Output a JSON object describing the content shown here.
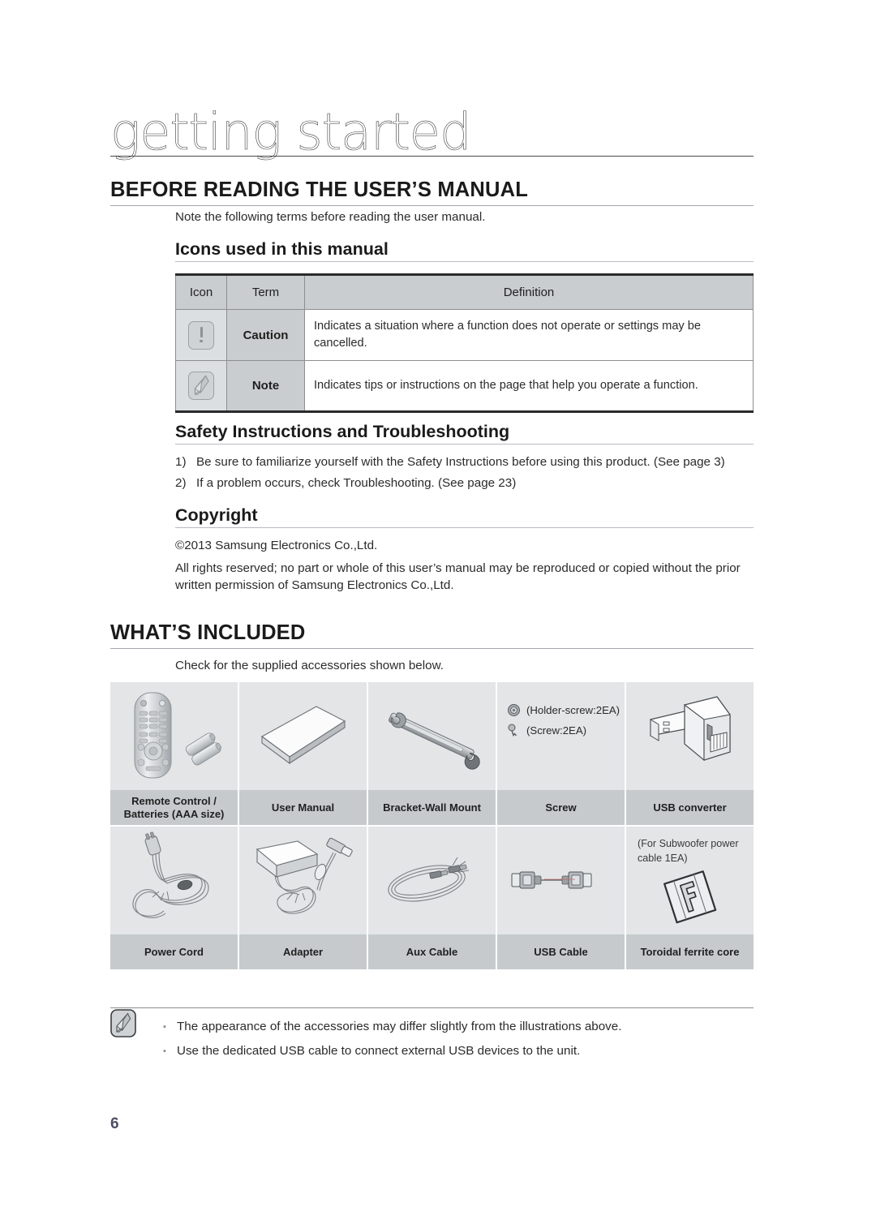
{
  "chapter": {
    "title": "getting started"
  },
  "section1": {
    "heading": "BEFORE READING THE USER’S MANUAL",
    "intro": "Note the following terms before reading the user manual.",
    "sub1": {
      "heading": "Icons used in this manual",
      "table": {
        "headers": [
          "Icon",
          "Term",
          "Definition"
        ],
        "rows": [
          {
            "icon": "caution-icon",
            "term": "Caution",
            "definition": "Indicates a situation where a function does not operate or settings may be cancelled."
          },
          {
            "icon": "note-icon",
            "term": "Note",
            "definition": "Indicates tips or instructions on the page that help you operate a function."
          }
        ]
      }
    },
    "sub2": {
      "heading": "Safety Instructions and Troubleshooting",
      "items": [
        {
          "num": "1)",
          "text": "Be sure to familiarize yourself with the Safety Instructions before using this product. (See page 3)"
        },
        {
          "num": "2)",
          "text": "If a problem occurs, check Troubleshooting. (See page 23)"
        }
      ]
    },
    "sub3": {
      "heading": "Copyright",
      "line1": "©2013 Samsung Electronics Co.,Ltd.",
      "line2": "All rights reserved; no part or whole of this user’s manual may be reproduced or copied without the prior written permission of Samsung Electronics Co.,Ltd."
    }
  },
  "section2": {
    "heading": "WHAT’S INCLUDED",
    "intro": "Check for the supplied accessories shown below.",
    "accessories": [
      {
        "art": "remote-control",
        "label": "Remote Control /\nBatteries (AAA size)"
      },
      {
        "art": "user-manual",
        "label": "User Manual"
      },
      {
        "art": "wall-mount-bracket",
        "label": "Bracket-Wall Mount"
      },
      {
        "art": "screws",
        "label": "Screw",
        "notes": [
          "(Holder-screw:2EA)",
          "(Screw:2EA)"
        ]
      },
      {
        "art": "usb-converter",
        "label": "USB converter"
      },
      {
        "art": "power-cord",
        "label": "Power Cord"
      },
      {
        "art": "adapter",
        "label": "Adapter"
      },
      {
        "art": "aux-cable",
        "label": "Aux Cable"
      },
      {
        "art": "usb-cable",
        "label": "USB Cable"
      },
      {
        "art": "ferrite-core",
        "label": "Toroidal ferrite core",
        "note": "(For Subwoofer power\ncable 1EA)"
      }
    ],
    "footnotes": [
      "The appearance of the accessories may differ slightly from the illustrations above.",
      "Use the dedicated USB cable to connect external USB devices to the unit."
    ]
  },
  "footer": {
    "page_number": "6"
  },
  "colors": {
    "table_header_bg": "#c9cdcf",
    "cell_icon_bg": "#dcdfe1",
    "acc_art_bg": "#e3e5e7",
    "acc_label_bg": "#c6cacd",
    "page_number": "#4c5066",
    "rule": "#a9a5ae"
  }
}
